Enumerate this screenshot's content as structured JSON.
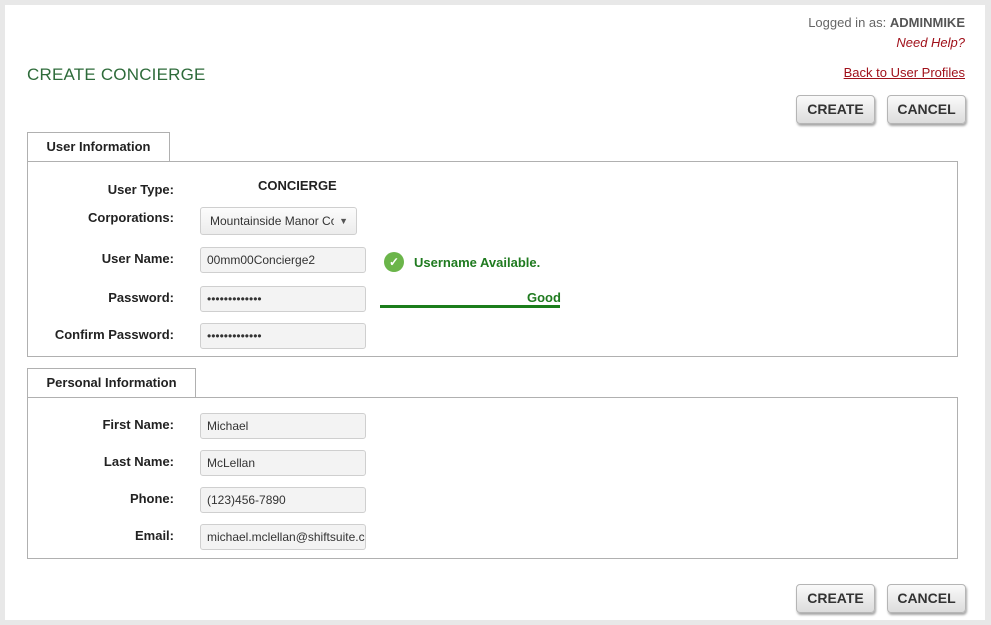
{
  "header": {
    "logged_in_prefix": "Logged in as:",
    "username": "ADMINMIKE",
    "help_link": "Need Help?",
    "page_title": "CREATE CONCIERGE",
    "back_link": "Back to User Profiles"
  },
  "actions": {
    "create_label": "CREATE",
    "cancel_label": "CANCEL"
  },
  "user_info": {
    "tab_label": "User Information",
    "user_type_label": "User Type:",
    "user_type_value": "CONCIERGE",
    "corporations_label": "Corporations:",
    "corporations_value": "Mountainside Manor Co",
    "username_label": "User Name:",
    "username_value": "00mm00Concierge2",
    "username_status": "Username Available.",
    "password_label": "Password:",
    "password_value": "•••••••••••••",
    "password_strength": "Good",
    "confirm_label": "Confirm Password:",
    "confirm_value": "•••••••••••••",
    "status_color": "#1f7a1f"
  },
  "personal_info": {
    "tab_label": "Personal Information",
    "first_name_label": "First Name:",
    "first_name_value": "Michael",
    "last_name_label": "Last Name:",
    "last_name_value": "McLellan",
    "phone_label": "Phone:",
    "phone_value": "(123)456-7890",
    "email_label": "Email:",
    "email_value": "michael.mclellan@shiftsuite.com"
  },
  "icons": {
    "status_icon": "check-circle-icon",
    "dropdown_icon": "chevron-down-icon"
  }
}
